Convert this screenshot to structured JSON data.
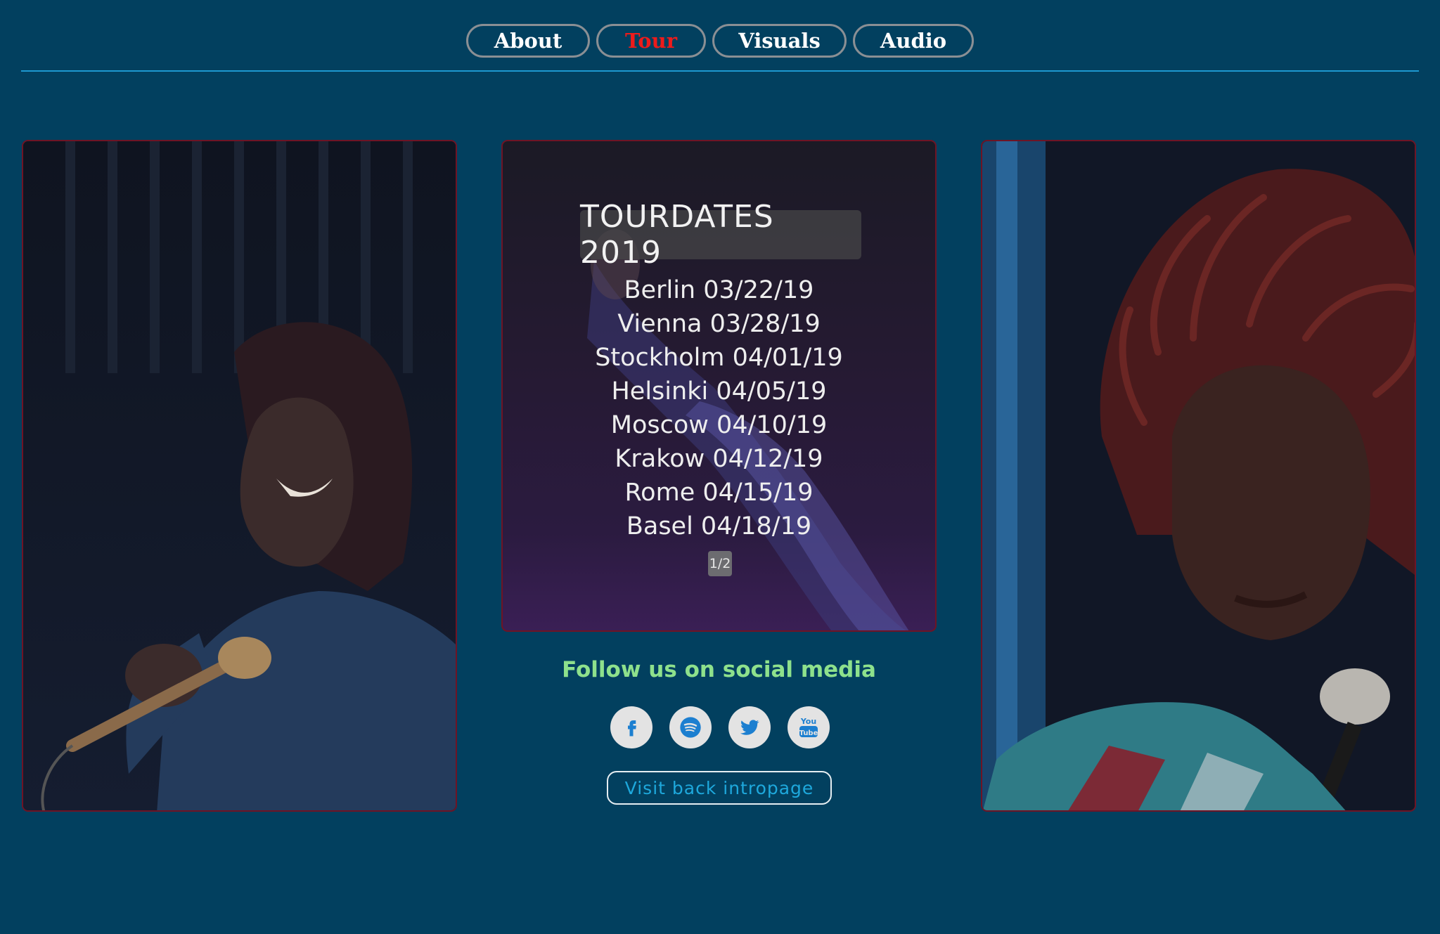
{
  "nav": {
    "items": [
      {
        "label": "About",
        "active": false
      },
      {
        "label": "Tour",
        "active": true
      },
      {
        "label": "Visuals",
        "active": false
      },
      {
        "label": "Audio",
        "active": false
      }
    ],
    "active_color": "#ee1b1b",
    "rule_color": "#1e98d0"
  },
  "tour": {
    "title": "TOURDATES 2019",
    "dates": [
      "Berlin 03/22/19",
      "Vienna 03/28/19",
      "Stockholm 04/01/19",
      "Helsinki 04/05/19",
      "Moscow 04/10/19",
      "Krakow 04/12/19",
      "Rome 04/15/19",
      "Basel 04/18/19"
    ],
    "page": "1/2"
  },
  "social": {
    "heading": "Follow us on social media",
    "heading_color": "#8ee18c",
    "icons": [
      "facebook-icon",
      "spotify-icon",
      "twitter-icon",
      "youtube-icon"
    ],
    "youtube_logo": [
      "You",
      "Tube"
    ],
    "icon_color": "#1c7fd0"
  },
  "intro_button": {
    "label": "Visit back intropage"
  },
  "colors": {
    "background": "#02405f",
    "panel_border": "#6e1425"
  }
}
